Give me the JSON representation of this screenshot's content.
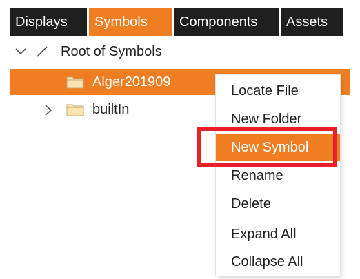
{
  "tabs": [
    {
      "label": "Displays"
    },
    {
      "label": "Symbols"
    },
    {
      "label": "Components"
    },
    {
      "label": "Assets"
    }
  ],
  "active_tab": "Symbols",
  "tree": {
    "root_label": "Root of Symbols",
    "items": [
      {
        "label": "Alger201909",
        "selected": true
      },
      {
        "label": "builtIn",
        "selected": false
      }
    ]
  },
  "context_menu": {
    "items": [
      {
        "label": "Locate File"
      },
      {
        "label": "New Folder"
      },
      {
        "label": "New Symbol",
        "highlighted": true
      },
      {
        "label": "Rename"
      },
      {
        "label": "Delete"
      },
      {
        "label": "Expand All"
      },
      {
        "label": "Collapse All"
      }
    ]
  },
  "colors": {
    "accent": "#ef7d22",
    "tab_dark": "#1f1f1f",
    "callout_red": "#e8202a",
    "folder_fill": "#fbe3b3"
  },
  "icons": {
    "root_expand": "chevron-down-icon",
    "root_symbol": "slash-icon",
    "folder": "folder-icon",
    "collapsed": "chevron-right-icon"
  }
}
